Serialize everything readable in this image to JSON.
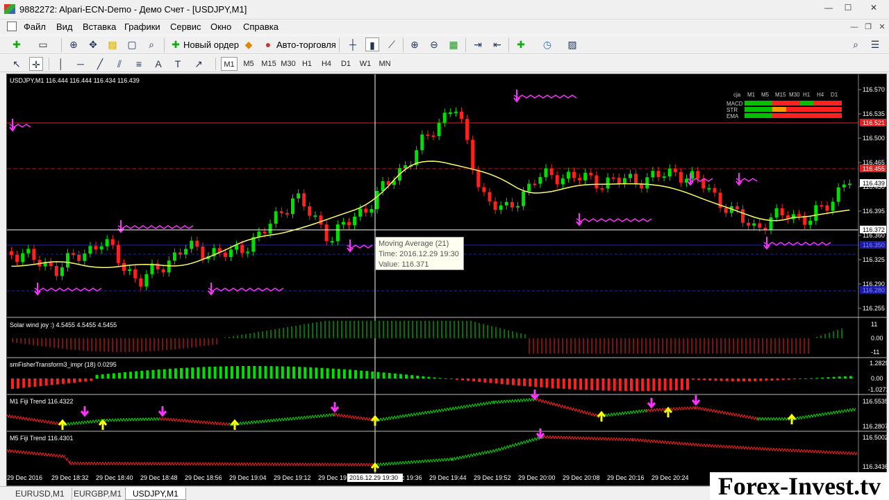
{
  "window": {
    "title": "9882272: Alpari-ECN-Demo - Демо Счет - [USDJPY,M1]"
  },
  "menu": [
    "Файл",
    "Вид",
    "Вставка",
    "Графики",
    "Сервис",
    "Окно",
    "Справка"
  ],
  "toolbar": {
    "new_order": "Новый ордер",
    "auto_trading": "Авто-торговля"
  },
  "timeframes": [
    "M1",
    "M5",
    "M15",
    "M30",
    "H1",
    "H4",
    "D1",
    "W1",
    "MN"
  ],
  "active_timeframe": "M1",
  "chart": {
    "header": "USDJPY,M1  116.444 116.444 116.434 116.439",
    "price_axis": [
      "116.570",
      "116.535",
      "116.500",
      "116.465",
      "116.430",
      "116.395",
      "116.360",
      "116.325",
      "116.290",
      "116.255"
    ],
    "price_labels": {
      "current": "116.439",
      "cross": "116.372",
      "red_line": "116.521",
      "dash_line": "116.455",
      "blue_line": "116.350",
      "blue_line2": "116.280"
    },
    "time_axis": [
      "29 Dec 2016",
      "29 Dec 18:32",
      "29 Dec 18:40",
      "29 Dec 18:48",
      "29 Dec 18:56",
      "29 Dec 19:04",
      "29 Dec 19:12",
      "29 Dec 19:20",
      "29 Dec 19:36",
      "29 Dec 19:44",
      "29 Dec 19:52",
      "29 Dec 20:00",
      "29 Dec 20:08",
      "29 Dec 20:16",
      "29 Dec 20:24"
    ],
    "cursor_time": "2016.12.29 19:30",
    "tooltip": {
      "line1": "Moving Average (21)",
      "line2": "Time: 2016.12.29 19:30",
      "line3": "Value: 116.371"
    },
    "matrix": {
      "header": [
        "cja",
        "M1",
        "M5",
        "M15",
        "M30",
        "H1",
        "H4",
        "D1"
      ],
      "rows": [
        {
          "name": "MACD",
          "colors": [
            "#00c000",
            "#00c000",
            "#ff2020",
            "#ff2020",
            "#00c000",
            "#ff2020",
            "#ff2020"
          ]
        },
        {
          "name": "STR",
          "colors": [
            "#00c000",
            "#00c000",
            "#ff9900",
            "#ff2020",
            "#ff2020",
            "#ff2020",
            "#ff2020"
          ]
        },
        {
          "name": "EMA",
          "colors": [
            "#00c000",
            "#00c000",
            "#ff2020",
            "#ff2020",
            "#ff2020",
            "#ff2020",
            "#ff2020"
          ]
        }
      ]
    }
  },
  "indicators": [
    {
      "label": "Solar wind joy :) 4.5455 4.5455 4.5455",
      "axis": [
        "11",
        "0.00",
        "-11"
      ]
    },
    {
      "label": "smFisherTransform3_impr  (18) 0.0295",
      "axis": [
        "1.2829",
        "0.00",
        "-1.0271"
      ]
    },
    {
      "label": "M1 Fiji Trend 116.4322",
      "axis": [
        "116.5535",
        "116.2807"
      ]
    },
    {
      "label": "M5 Fiji Trend 116.4301",
      "axis": [
        "116.5002",
        "116.3436"
      ]
    }
  ],
  "tabs": [
    "EURUSD,M1",
    "EURGBP,M1",
    "USDJPY,M1"
  ],
  "active_tab": "USDJPY,M1",
  "watermark": "Forex-Invest.tv",
  "colors": {
    "bull": "#00e000",
    "bear": "#ff2020",
    "ma": "#ffff66",
    "background": "#000000"
  }
}
